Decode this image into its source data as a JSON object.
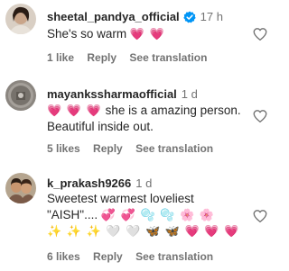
{
  "comments": [
    {
      "username": "sheetal_pandya_official",
      "verified": true,
      "time": "17 h",
      "text": "She's so warm",
      "emojis": "💗 💗",
      "likes": "1 like",
      "reply": "Reply",
      "see_translation": "See translation"
    },
    {
      "username": "mayankssharmaofficial",
      "verified": false,
      "time": "1 d",
      "emojis": "💗 💗 💗",
      "text_line1": "she is a amazing person.",
      "text_line2": "Beautiful inside out.",
      "likes": "5 likes",
      "reply": "Reply",
      "see_translation": "See translation"
    },
    {
      "username": "k_prakash9266",
      "verified": false,
      "time": "1 d",
      "text_line1": "Sweetest warmest loveliest",
      "text_line2": "\"AISH\"....",
      "emojis_line2": "💞 💞 🫧 🫧 🌸 🌸",
      "emojis_line3": "✨ ✨ ✨ 🤍 🤍 🦋 🦋 💗 💗 💗",
      "likes": "6 likes",
      "reply": "Reply",
      "see_translation": "See translation"
    }
  ],
  "colors": {
    "accent_heart": "#e8264f",
    "verified_blue": "#0095f6",
    "muted_text": "#737373"
  }
}
